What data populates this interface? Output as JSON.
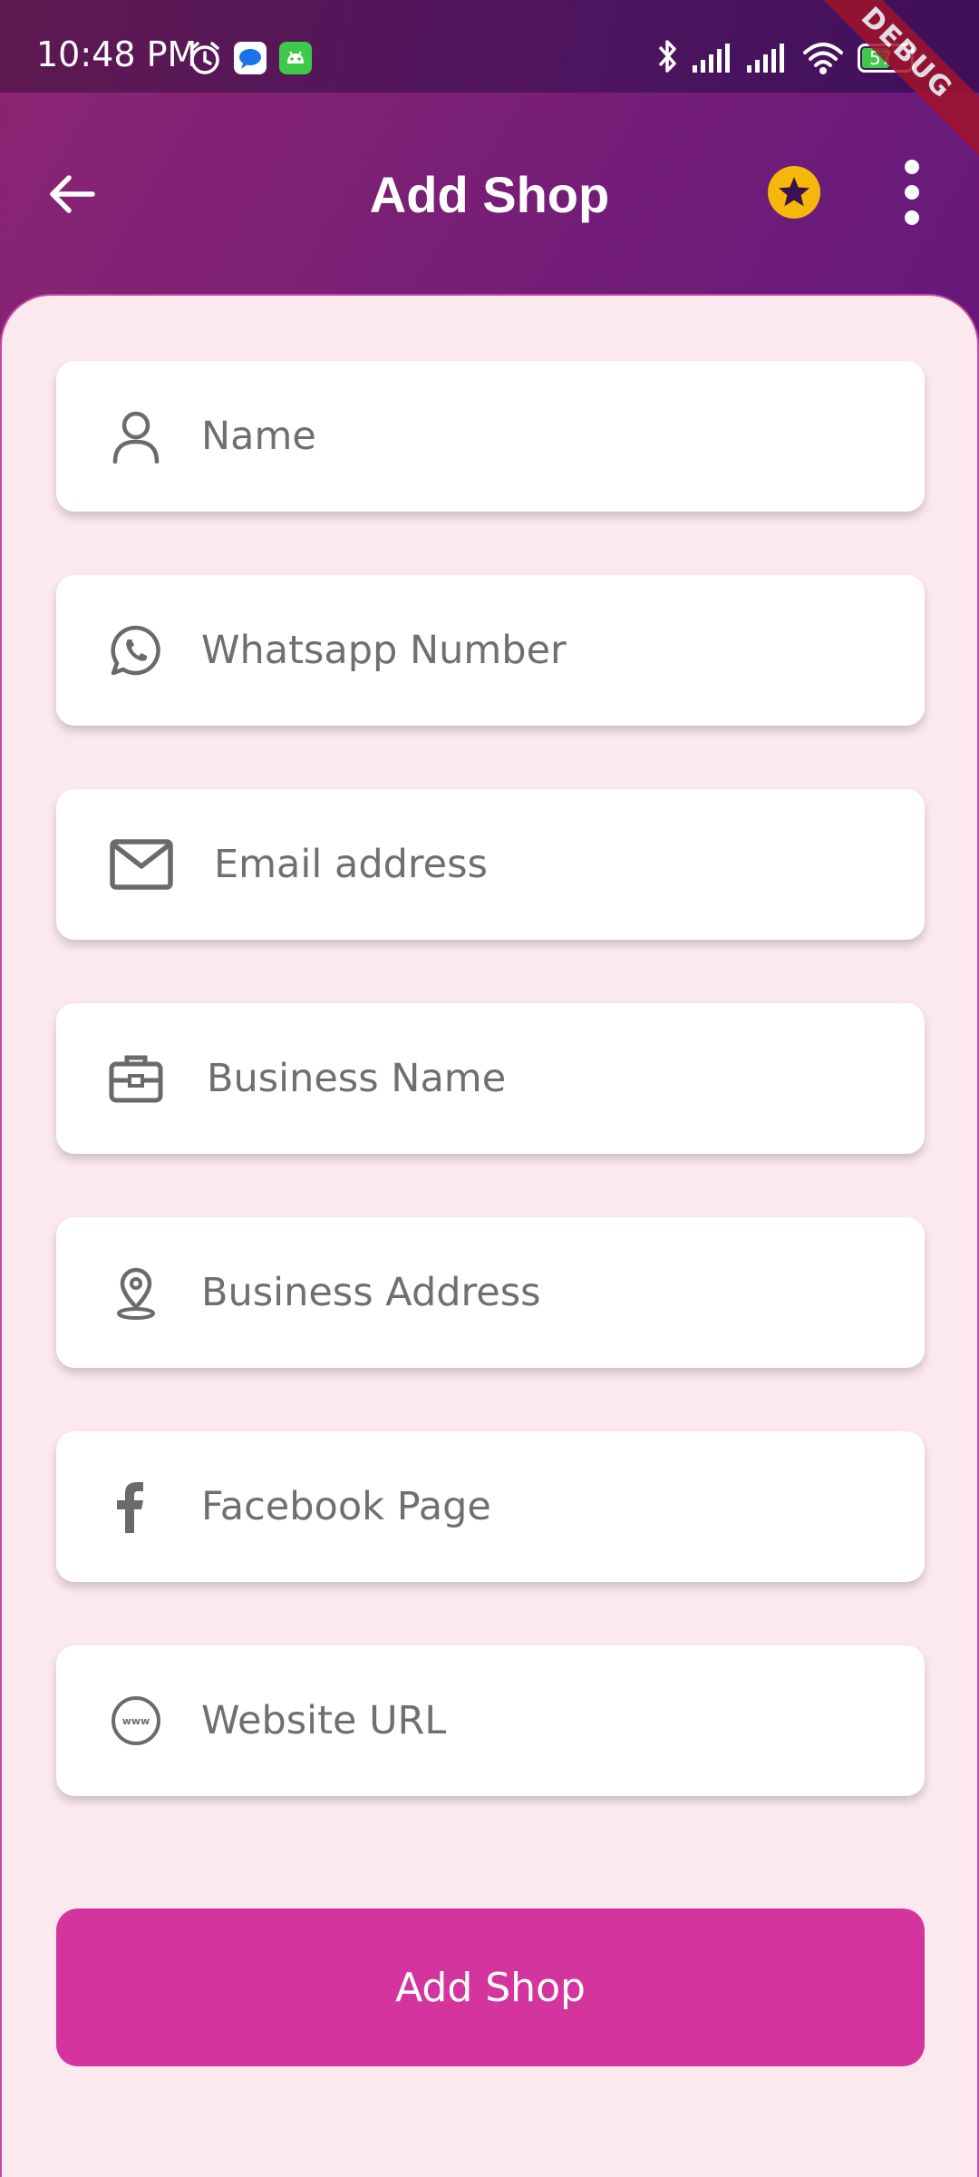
{
  "status_bar": {
    "time": "10:48 PM",
    "battery": "57",
    "debug_label": "DEBUG",
    "icons": [
      "alarm-icon",
      "messages-icon",
      "android-app-icon",
      "bluetooth-icon",
      "signal-icon",
      "signal-icon",
      "wifi-icon",
      "battery-icon"
    ]
  },
  "app_bar": {
    "title": "Add Shop",
    "icons": [
      "back-arrow-icon",
      "star-icon",
      "more-vert-icon"
    ],
    "star_color": "#f5b70a"
  },
  "form": {
    "fields": [
      {
        "placeholder": "Name",
        "icon": "person-icon"
      },
      {
        "placeholder": "Whatsapp Number",
        "icon": "whatsapp-icon"
      },
      {
        "placeholder": "Email address",
        "icon": "mail-icon"
      },
      {
        "placeholder": "Business Name",
        "icon": "briefcase-icon"
      },
      {
        "placeholder": "Business Address",
        "icon": "location-pin-icon"
      },
      {
        "placeholder": "Facebook Page",
        "icon": "facebook-icon"
      },
      {
        "placeholder": "Website URL",
        "icon": "www-globe-icon"
      }
    ],
    "submit_label": "Add Shop",
    "accent_color": "#d4349e",
    "sheet_color": "#fce9ee"
  }
}
